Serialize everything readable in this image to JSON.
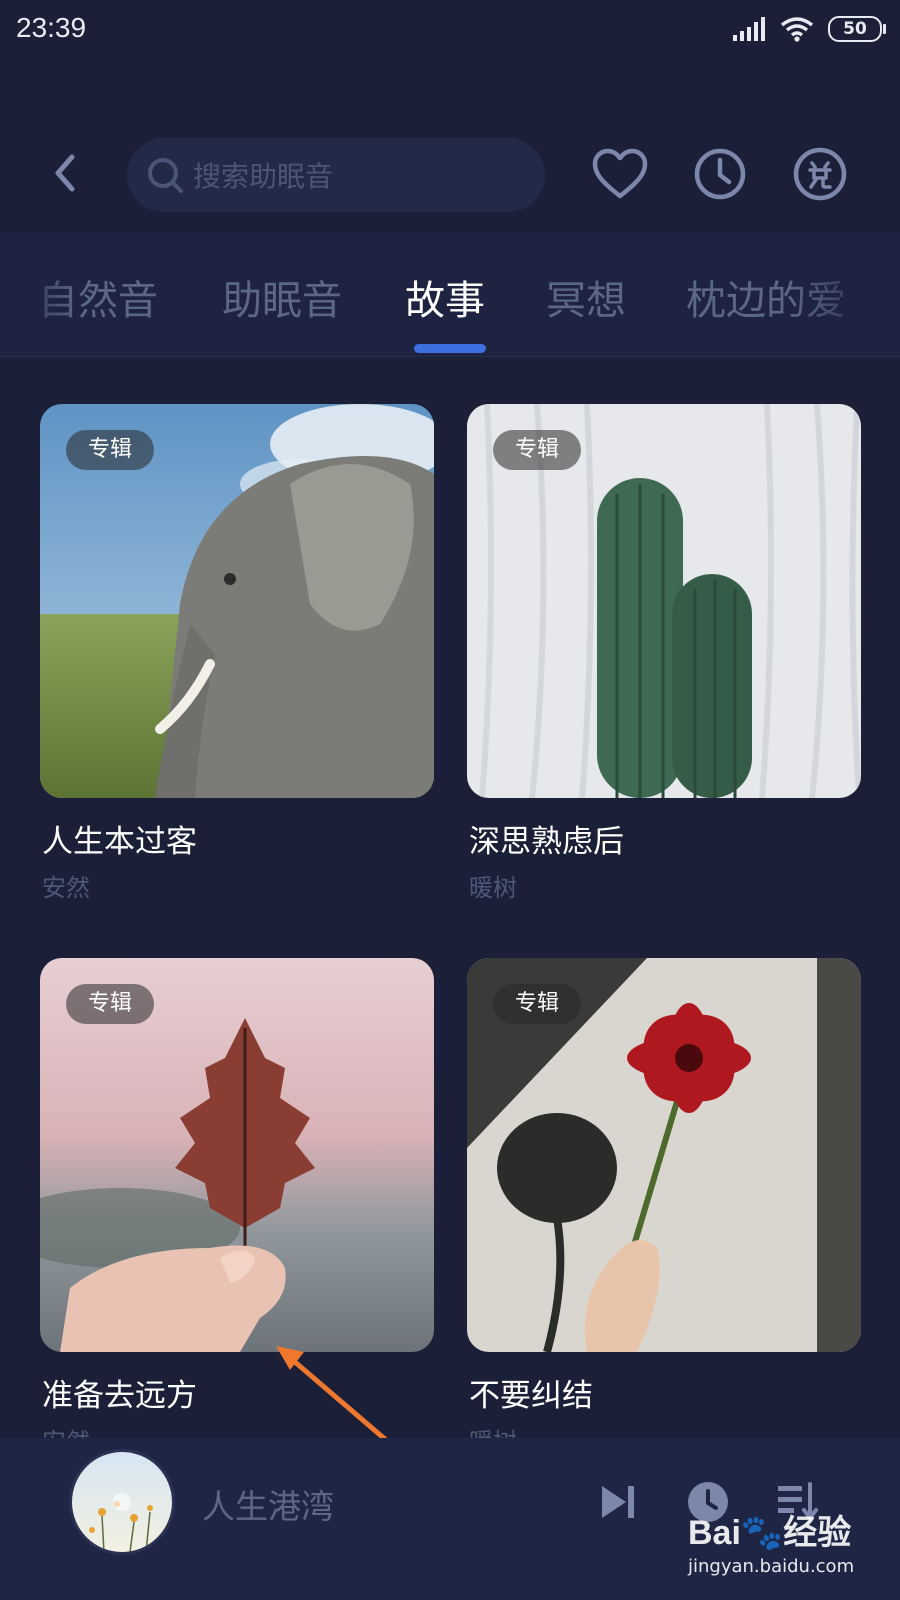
{
  "status_bar": {
    "time": "23:39",
    "battery": "50"
  },
  "search": {
    "placeholder": "搜索助眠音"
  },
  "tabs": [
    {
      "label": "自然音"
    },
    {
      "label": "助眠音"
    },
    {
      "label": "故事"
    },
    {
      "label": "冥想"
    },
    {
      "label": "枕边的爱"
    }
  ],
  "active_tab": "故事",
  "albums": [
    {
      "badge": "专辑",
      "title": "人生本过客",
      "author": "安然"
    },
    {
      "badge": "专辑",
      "title": "深思熟虑后",
      "author": "暖树"
    },
    {
      "badge": "专辑",
      "title": "准备去远方",
      "author": "安然"
    },
    {
      "badge": "专辑",
      "title": "不要纠结",
      "author": "暖树"
    }
  ],
  "player": {
    "title": "人生港湾"
  },
  "watermark": {
    "brand": "Bai",
    "brand_suffix": "经验",
    "url": "jingyan.baidu.com"
  },
  "colors": {
    "background": "#1b2038",
    "accent": "#3e6fe0",
    "annotation_arrow": "#f0772e"
  },
  "icons": [
    "back-icon",
    "search-icon",
    "heart-icon",
    "clock-icon",
    "redeem-icon",
    "skip-next-icon",
    "timer-icon",
    "playlist-icon"
  ]
}
